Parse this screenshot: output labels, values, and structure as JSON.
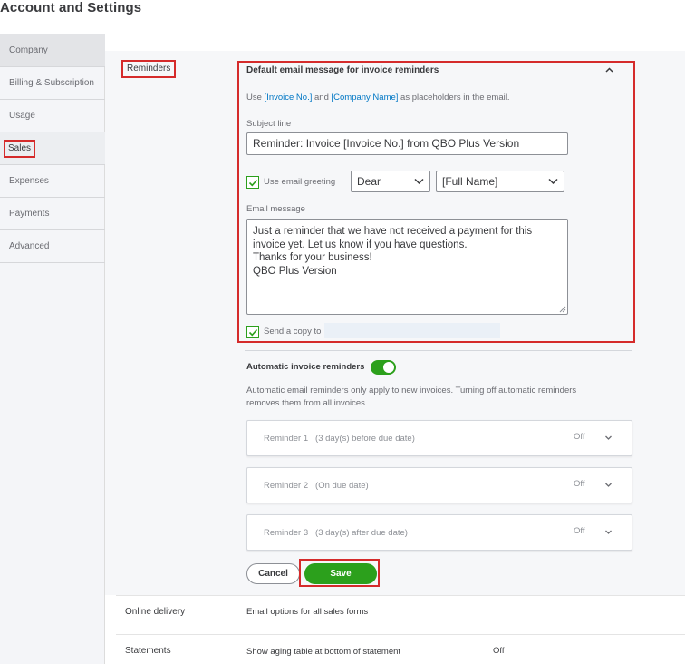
{
  "page_title": "Account and Settings",
  "sidebar": {
    "items": [
      {
        "label": "Company"
      },
      {
        "label": "Billing & Subscription"
      },
      {
        "label": "Usage"
      },
      {
        "label": "Sales"
      },
      {
        "label": "Expenses"
      },
      {
        "label": "Payments"
      },
      {
        "label": "Advanced"
      }
    ],
    "active": "Sales"
  },
  "reminders": {
    "section_label": "Reminders",
    "heading": "Default email message for invoice reminders",
    "placeholder_note": {
      "pre": "Use ",
      "link1": "[Invoice No.]",
      "mid": " and ",
      "link2": "[Company Name]",
      "post": " as placeholders in the email."
    },
    "subject_label": "Subject line",
    "subject_value": "Reminder: Invoice [Invoice No.] from QBO Plus Version",
    "greeting_label": "Use email greeting",
    "greeting_checked": true,
    "greeting_salutation": "Dear",
    "greeting_name": "[Full Name]",
    "email_message_label": "Email message",
    "email_message_lines": [
      "Just a reminder that we have not received a payment for this",
      "invoice yet. Let us know if you have questions.",
      "",
      "Thanks for your business!",
      "QBO Plus Version"
    ],
    "send_copy_label": "Send a copy to",
    "send_copy_checked": true,
    "auto_label": "Automatic invoice reminders",
    "auto_enabled": true,
    "auto_note_line1": "Automatic email reminders only apply to new invoices. Turning off automatic reminders",
    "auto_note_line2": "removes them from all invoices.",
    "reminder_cards": [
      {
        "name": "Reminder 1",
        "detail": "(3 day(s) before due date)",
        "status": "Off"
      },
      {
        "name": "Reminder 2",
        "detail": "(On due date)",
        "status": "Off"
      },
      {
        "name": "Reminder 3",
        "detail": "(3 day(s) after due date)",
        "status": "Off"
      }
    ],
    "cancel_label": "Cancel",
    "save_label": "Save"
  },
  "online_delivery": {
    "label": "Online delivery",
    "text": "Email options for all sales forms"
  },
  "statements": {
    "label": "Statements",
    "text": "Show aging table at bottom of statement",
    "value": "Off"
  },
  "colors": {
    "accent_green": "#2ca01c",
    "link_blue": "#0077c5",
    "highlight_red": "#d52b2b"
  }
}
